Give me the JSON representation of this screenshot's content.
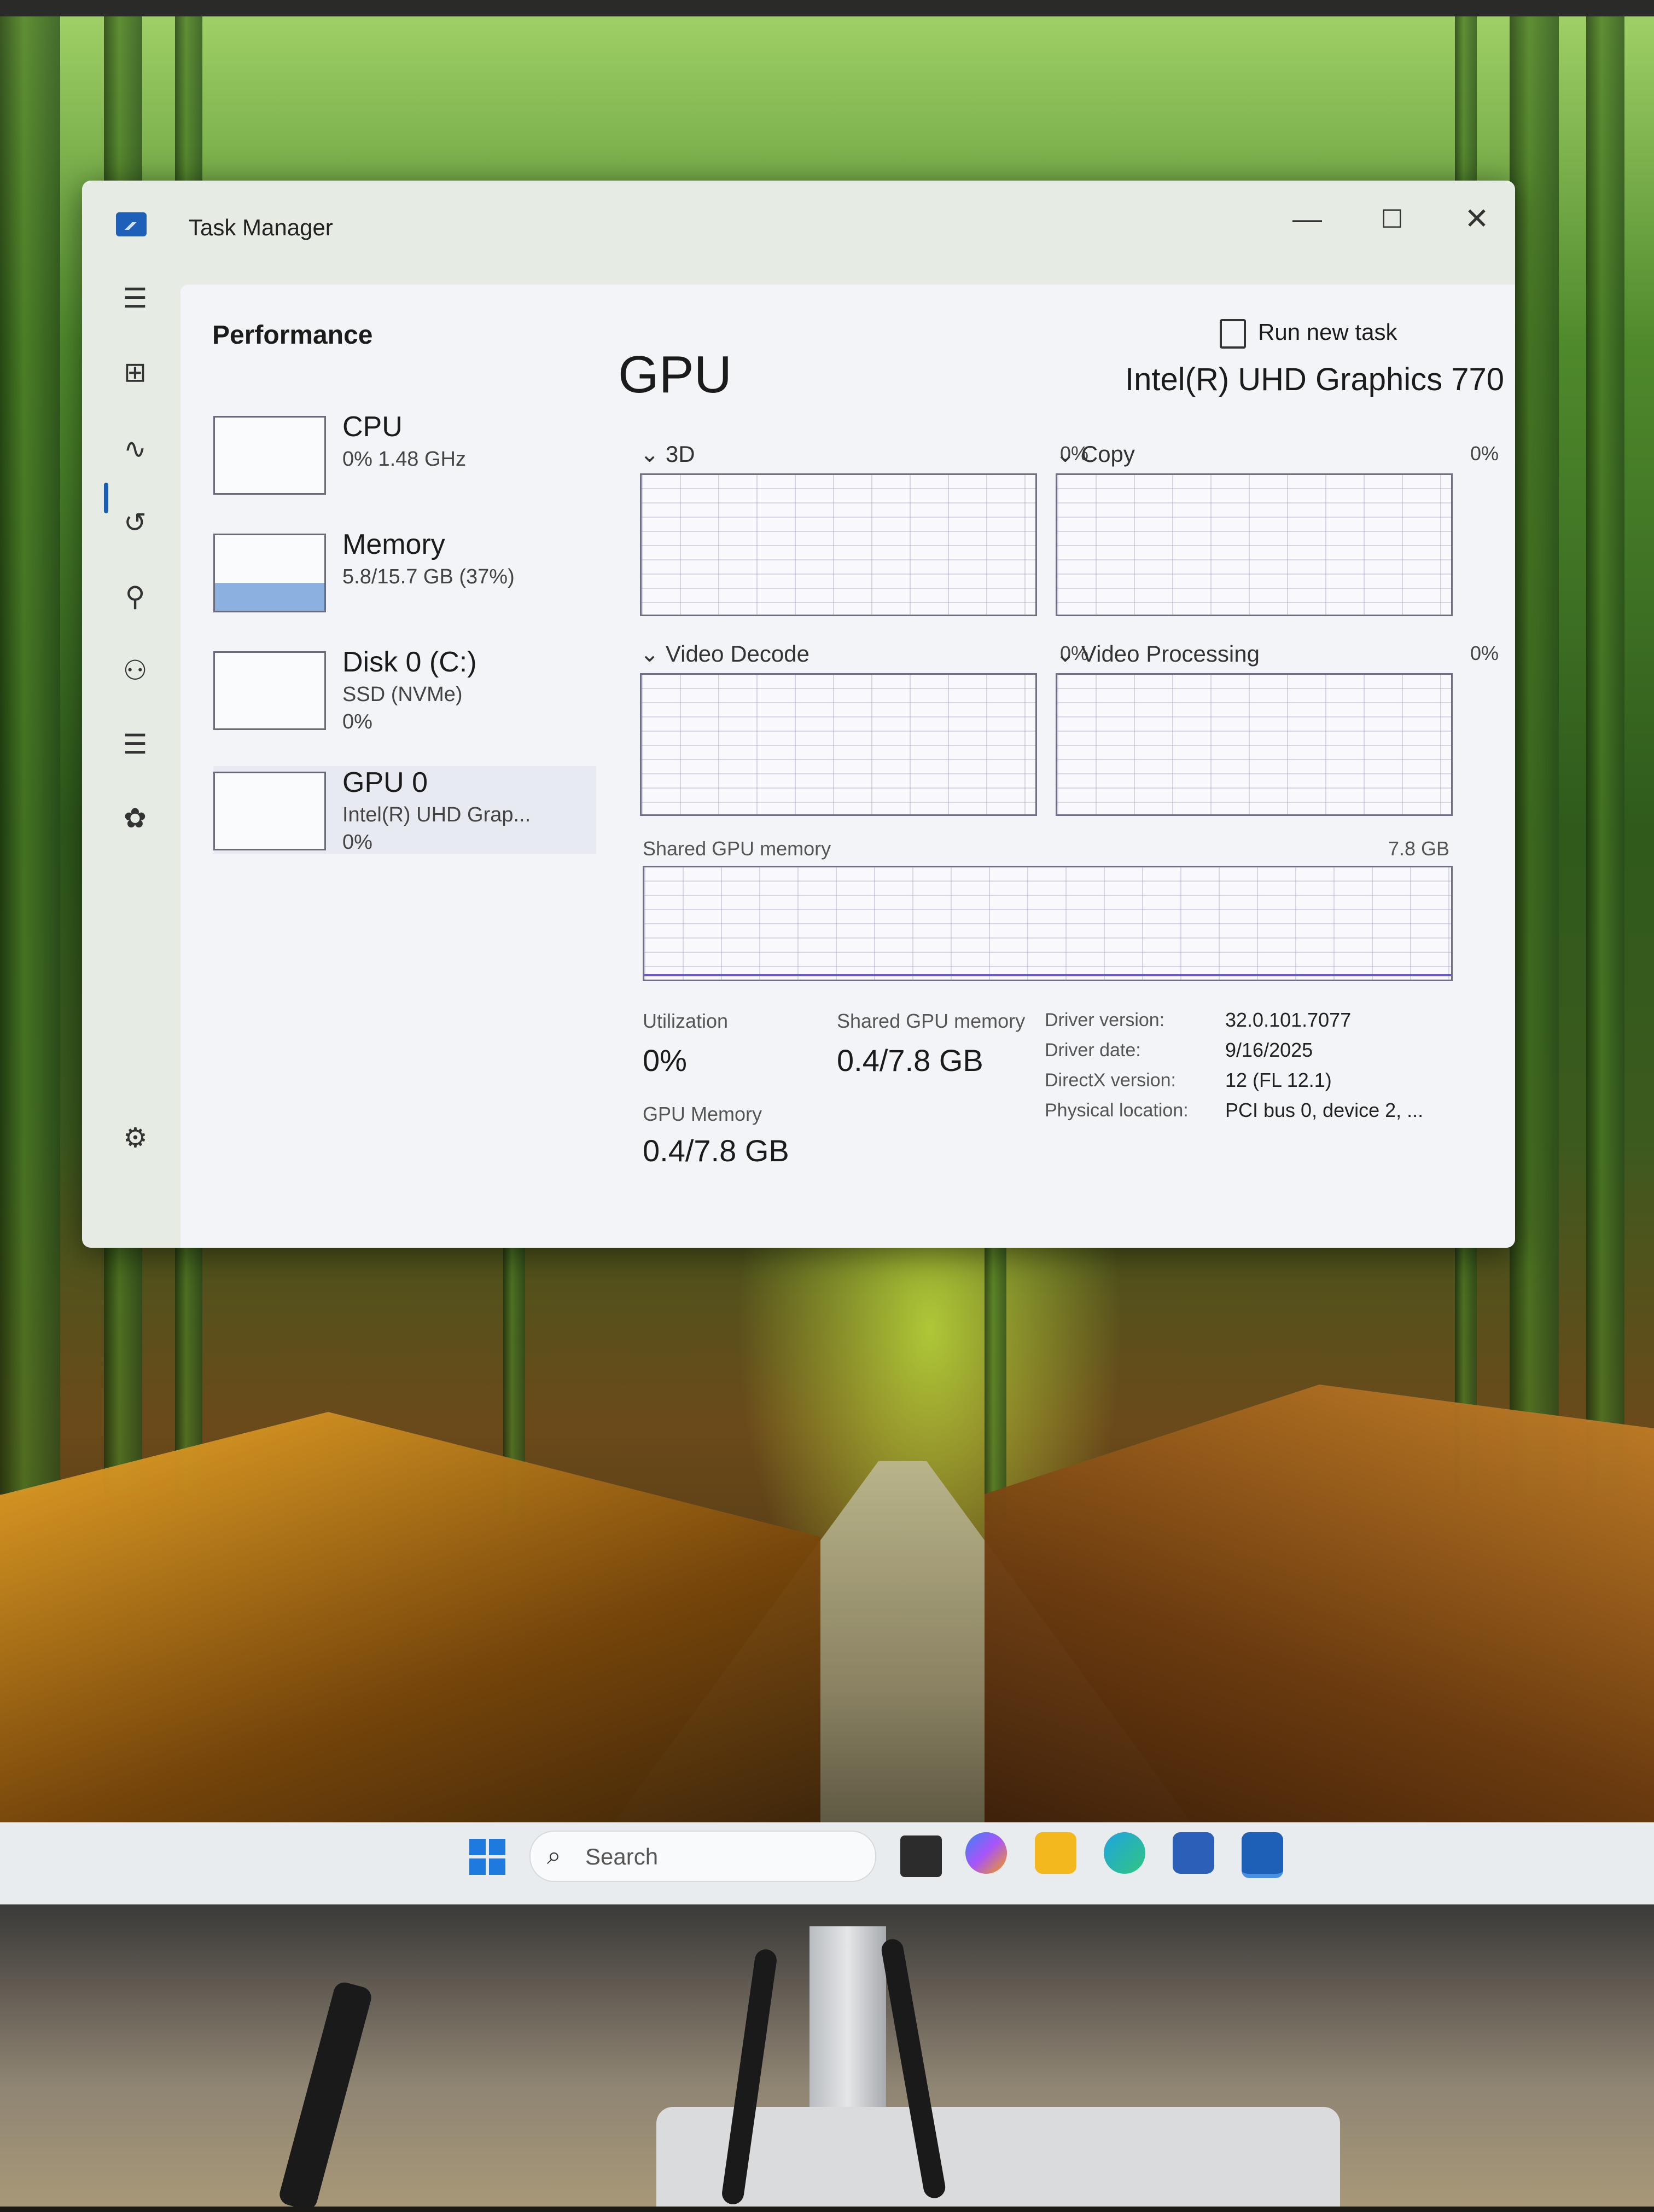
{
  "window": {
    "title": "Task Manager",
    "minimize": "—",
    "maximize": "☐",
    "close": "✕"
  },
  "header": {
    "title": "Performance",
    "run_new_task": "Run new task",
    "more": "···"
  },
  "nav": {
    "hamburger": "☰",
    "processes": "⊞",
    "performance": "∿",
    "app_history": "↺",
    "startup": "⚲",
    "users": "⚇",
    "details": "☰",
    "services": "✿",
    "settings": "⚙"
  },
  "devices": [
    {
      "name": "CPU",
      "sub": "0% 1.48 GHz",
      "sub2": ""
    },
    {
      "name": "Memory",
      "sub": "5.8/15.7 GB (37%)",
      "sub2": ""
    },
    {
      "name": "Disk 0 (C:)",
      "sub": "SSD (NVMe)",
      "sub2": "0%"
    },
    {
      "name": "GPU 0",
      "sub": "Intel(R) UHD Grap...",
      "sub2": "0%"
    }
  ],
  "memory_usage_percent": 37,
  "gpu": {
    "title": "GPU",
    "model": "Intel(R) UHD Graphics 770",
    "engines": [
      {
        "label": "⌄ 3D",
        "pct": "0%"
      },
      {
        "label": "⌄ Copy",
        "pct": "0%"
      },
      {
        "label": "⌄ Video Decode",
        "pct": "0%"
      },
      {
        "label": "⌄ Video Processing",
        "pct": "0%"
      }
    ],
    "shared_memory_label": "Shared GPU memory",
    "shared_memory_max": "7.8 GB",
    "stats": {
      "utilization_label": "Utilization",
      "utilization_value": "0%",
      "shared_label": "Shared GPU memory",
      "shared_value": "0.4/7.8 GB",
      "gpu_memory_label": "GPU Memory",
      "gpu_memory_value": "0.4/7.8 GB"
    },
    "details": [
      {
        "label": "Driver version:",
        "value": "32.0.101.7077"
      },
      {
        "label": "Driver date:",
        "value": "9/16/2025"
      },
      {
        "label": "DirectX version:",
        "value": "12 (FL 12.1)"
      },
      {
        "label": "Physical location:",
        "value": "PCI bus 0, device 2, ..."
      }
    ]
  },
  "taskbar": {
    "search_placeholder": "Search",
    "search_icon": "⌕"
  }
}
